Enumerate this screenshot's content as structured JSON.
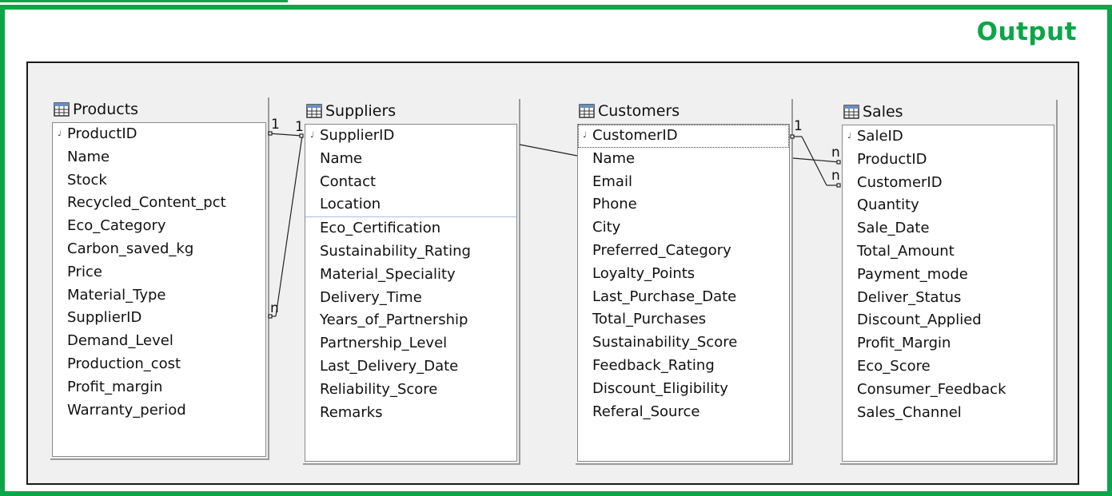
{
  "header": {
    "title": "Output"
  },
  "tables": [
    {
      "id": "products",
      "name": "Products",
      "fields": [
        "ProductID",
        "Name",
        "Stock",
        "Recycled_Content_pct",
        "Eco_Category",
        "Carbon_saved_kg",
        "Price",
        "Material_Type",
        "SupplierID",
        "Demand_Level",
        "Production_cost",
        "Profit_margin",
        "Warranty_period"
      ],
      "primary_key": "ProductID"
    },
    {
      "id": "suppliers",
      "name": "Suppliers",
      "fields": [
        "SupplierID",
        "Name",
        "Contact",
        "Location",
        "Eco_Certification",
        "Sustainability_Rating",
        "Material_Speciality",
        "Delivery_Time",
        "Years_of_Partnership",
        "Partnership_Level",
        "Last_Delivery_Date",
        "Reliability_Score",
        "Remarks"
      ],
      "primary_key": "SupplierID"
    },
    {
      "id": "customers",
      "name": "Customers",
      "fields": [
        "CustomerID",
        "Name",
        "Email",
        "Phone",
        "City",
        "Preferred_Category",
        "Loyalty_Points",
        "Last_Purchase_Date",
        "Total_Purchases",
        "Sustainability_Score",
        "Feedback_Rating",
        "Discount_Eligibility",
        "Referal_Source"
      ],
      "primary_key": "CustomerID",
      "selected_field": "CustomerID"
    },
    {
      "id": "sales",
      "name": "Sales",
      "fields": [
        "SaleID",
        "ProductID",
        "CustomerID",
        "Quantity",
        "Sale_Date",
        "Total_Amount",
        "Payment_mode",
        "Deliver_Status",
        "Discount_Applied",
        "Profit_Margin",
        "Eco_Score",
        "Consumer_Feedback",
        "Sales_Channel"
      ],
      "primary_key": "SaleID"
    }
  ],
  "relationships": [
    {
      "from": "Products",
      "to": "Suppliers",
      "from_card": "1",
      "to_card": "1"
    },
    {
      "from": "Products",
      "to": "Suppliers",
      "from_card": "n",
      "to_card": ""
    },
    {
      "from": "Customers",
      "to": "Sales",
      "from_card": "1",
      "to_card": "n"
    },
    {
      "from": "Customers",
      "to": "Sales",
      "from_card": "",
      "to_card": "n"
    }
  ],
  "labels": {
    "products_top_1": "1",
    "suppliers_top_1": "1",
    "products_n": "n",
    "customers_1": "1",
    "sales_n1": "n",
    "sales_n2": "n"
  },
  "colors": {
    "accent": "#0aa647",
    "canvas": "#f0f0f0",
    "divider": "#a9c1dc"
  },
  "icons": {
    "table": "table-grid-icon",
    "key": "primary-key-icon"
  }
}
